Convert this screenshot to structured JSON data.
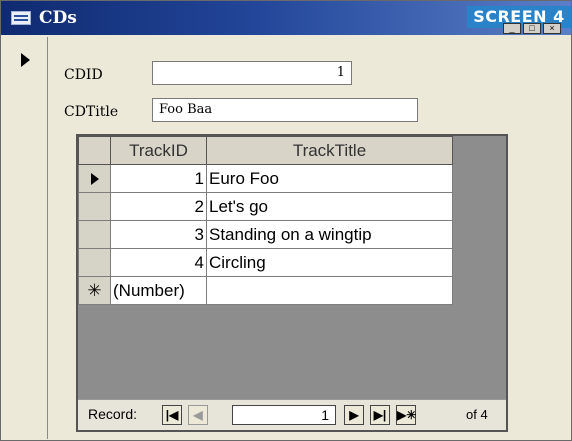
{
  "window": {
    "title": "CDs",
    "screen_label": "SCREEN 4"
  },
  "form": {
    "cdid_label": "CDID",
    "cdid_value": "1",
    "cdtitle_label": "CDTitle",
    "cdtitle_value": "Foo Baa"
  },
  "subform": {
    "columns": [
      "TrackID",
      "TrackTitle"
    ],
    "rows": [
      {
        "id": "1",
        "title": "Euro Foo"
      },
      {
        "id": "2",
        "title": "Let's go"
      },
      {
        "id": "3",
        "title": "Standing on a wingtip"
      },
      {
        "id": "4",
        "title": "Circling"
      }
    ],
    "new_row_placeholder": "(Number)"
  },
  "navigation": {
    "record_label": "Record:",
    "current_record": "1",
    "of_text": "of 4"
  }
}
